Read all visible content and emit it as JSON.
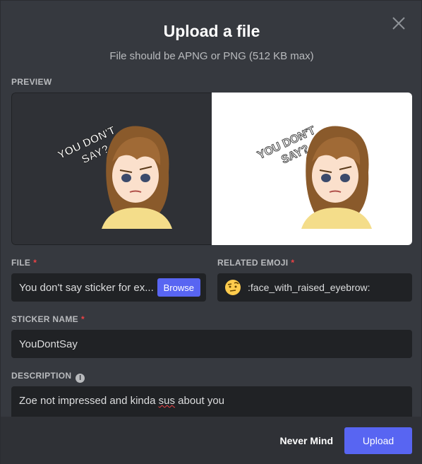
{
  "dialog": {
    "title": "Upload a file",
    "subtitle": "File should be APNG or PNG (512 KB max)"
  },
  "preview": {
    "label": "PREVIEW",
    "sticker_text_line1": "YOU DON'T",
    "sticker_text_line2": "SAY?"
  },
  "file": {
    "label": "FILE",
    "required_mark": "*",
    "value": "You don't say sticker for ex...",
    "browse_label": "Browse"
  },
  "related_emoji": {
    "label": "RELATED EMOJI",
    "required_mark": "*",
    "icon": "face-with-raised-eyebrow-emoji",
    "value": ":face_with_raised_eyebrow:"
  },
  "sticker_name": {
    "label": "STICKER NAME",
    "required_mark": "*",
    "value": "YouDontSay"
  },
  "description": {
    "label": "DESCRIPTION",
    "info_icon": "i",
    "value_before": "Zoe not impressed and kinda ",
    "value_misspelled": "sus",
    "value_after": " about you"
  },
  "footer": {
    "cancel_label": "Never Mind",
    "upload_label": "Upload"
  },
  "colors": {
    "background": "#36393f",
    "input": "#202225",
    "accent": "#5865f2",
    "required": "#ed4245"
  }
}
